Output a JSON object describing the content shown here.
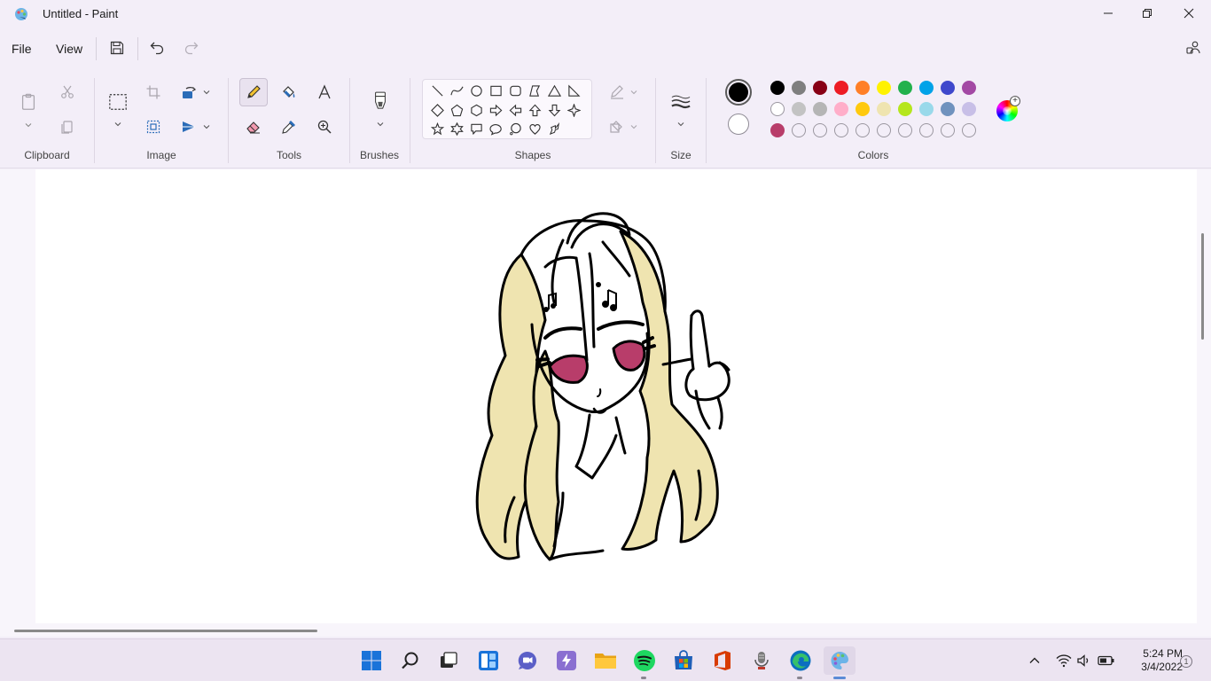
{
  "window": {
    "title": "Untitled - Paint"
  },
  "menu": {
    "file": "File",
    "view": "View"
  },
  "ribbon": {
    "groups": {
      "clipboard": "Clipboard",
      "image": "Image",
      "tools": "Tools",
      "brushes": "Brushes",
      "shapes": "Shapes",
      "size": "Size",
      "colors": "Colors"
    },
    "palette_row1": [
      "#000000",
      "#7f7f7f",
      "#880015",
      "#ed1c24",
      "#ff7f27",
      "#fff200",
      "#22b14c",
      "#00a2e8",
      "#3f48cc",
      "#a349a4"
    ],
    "palette_row2": [
      "#ffffff",
      "#c3c3c3",
      "#b5b5b5",
      "#ffaec9",
      "#ffc90e",
      "#efe4b0",
      "#b5e61d",
      "#99d9ea",
      "#7092be",
      "#c8bfe7"
    ],
    "palette_row3_first": "#b83d6a",
    "color1": "#000000",
    "color2": "#ffffff"
  },
  "drawing": {
    "hair_color": "#efe4b0",
    "eye_color": "#b83d6a"
  },
  "taskbar": {
    "time": "5:24 PM",
    "date": "3/4/2022",
    "notifications": "1"
  }
}
